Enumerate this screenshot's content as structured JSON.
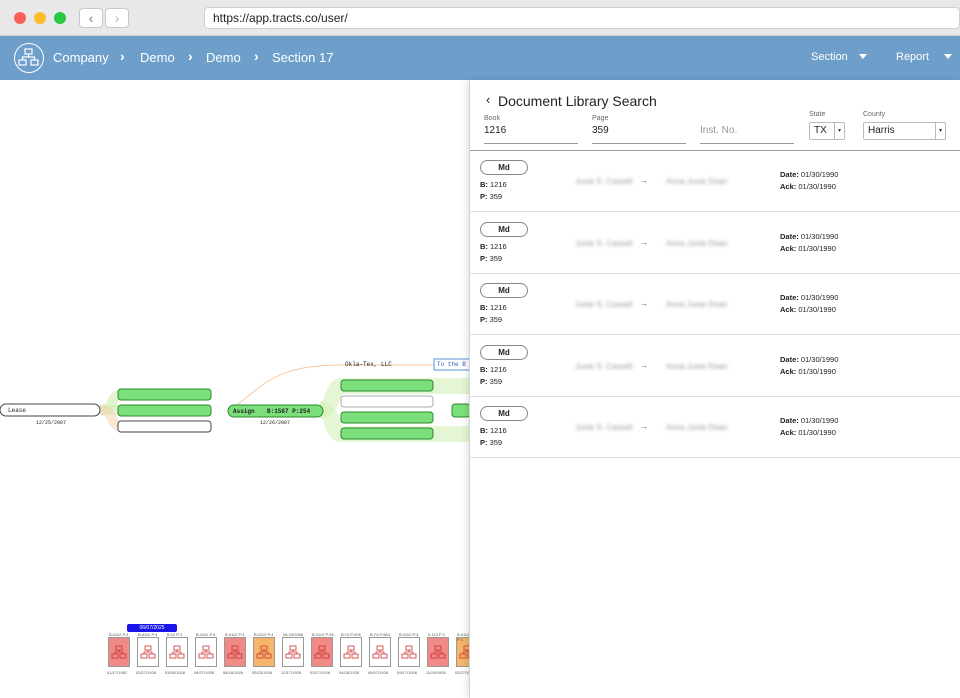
{
  "browser": {
    "url": "https://app.tracts.co/user/"
  },
  "header": {
    "breadcrumbs": [
      "Company",
      "Demo",
      "Demo",
      "Section 17"
    ],
    "menus": [
      "Section",
      "Report"
    ]
  },
  "canvas": {
    "nodes": {
      "lease": "Lease",
      "lease_date": "12/25/2007",
      "assign": "Assign",
      "assign_ref": "B:1587 P:254",
      "assign_date": "12/26/2007",
      "okla": "Okla-Tex, LLC",
      "to_the": "To the B"
    },
    "timeline": {
      "badge": "06/07/2025",
      "docs": [
        {
          "top": "B:4112 P:4",
          "date": "01/17/1962",
          "color": "red"
        },
        {
          "top": "B:4112 P:4",
          "date": "03/27/1926",
          "color": "white"
        },
        {
          "top": "B:12 P:1",
          "date": "03/30/1928",
          "color": "white"
        },
        {
          "top": "B:4112 P:4",
          "date": "04/27/1926",
          "color": "white"
        },
        {
          "top": "B:4112 P:4",
          "date": "06/18/1926",
          "color": "red"
        },
        {
          "top": "B:4112 P:4",
          "date": "05/23/1926",
          "color": "orange"
        },
        {
          "top": "06-19/2006",
          "date": "12/17/1926",
          "color": "white"
        },
        {
          "top": "B:3112 P:26",
          "date": "03/17/1926",
          "color": "red"
        },
        {
          "top": "B:74 P:926",
          "date": "04/28/1926",
          "color": "white"
        },
        {
          "top": "B:74 P:984",
          "date": "06/07/1926",
          "color": "white"
        },
        {
          "top": "B:4112 P:4",
          "date": "09/17/1926",
          "color": "white"
        },
        {
          "top": "0-112 P:1",
          "date": "11/26/1926",
          "color": "red"
        },
        {
          "top": "B:4112 P:4",
          "date": "02/27/1927",
          "color": "orange"
        }
      ]
    }
  },
  "panel": {
    "title": "Document Library Search",
    "fields": {
      "book": {
        "label": "Book",
        "value": "1216"
      },
      "page": {
        "label": "Page",
        "value": "359"
      },
      "inst": {
        "label": "",
        "placeholder": "Inst. No."
      },
      "state": {
        "label": "State",
        "value": "TX"
      },
      "county": {
        "label": "County",
        "value": "Harris"
      }
    },
    "results": [
      {
        "type": "Md",
        "book": "1216",
        "page": "359",
        "grantor": "Junie S. Cassell",
        "grantee": "Anna Junie Doan",
        "date": "01/30/1990",
        "ack": "01/30/1990"
      },
      {
        "type": "Md",
        "book": "1216",
        "page": "359",
        "grantor": "Junie S. Cassell",
        "grantee": "Anna Junie Doan",
        "date": "01/30/1990",
        "ack": "01/30/1990"
      },
      {
        "type": "Md",
        "book": "1216",
        "page": "359",
        "grantor": "Junie S. Cassell",
        "grantee": "Anna Junie Doan",
        "date": "01/30/1990",
        "ack": "01/30/1990"
      },
      {
        "type": "Md",
        "book": "1216",
        "page": "359",
        "grantor": "Junie S. Cassell",
        "grantee": "Anna Junie Doan",
        "date": "01/30/1990",
        "ack": "01/30/1990"
      },
      {
        "type": "Md",
        "book": "1216",
        "page": "359",
        "grantor": "Junie S. Cassell",
        "grantee": "Anna Junie Doan",
        "date": "01/30/1990",
        "ack": "01/30/1990"
      }
    ],
    "labels": {
      "b": "B:",
      "p": "P:",
      "date": "Date:",
      "ack": "Ack:"
    }
  }
}
